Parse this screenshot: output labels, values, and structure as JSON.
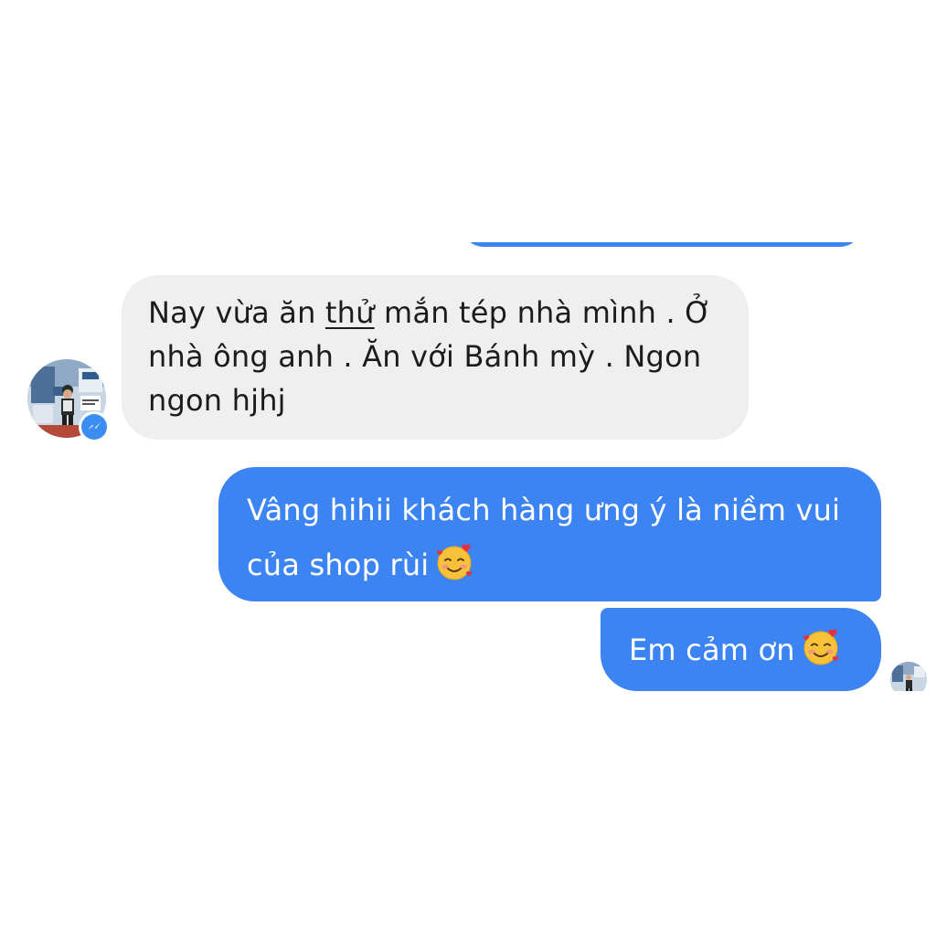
{
  "conversation": {
    "incoming": {
      "lines": [
        {
          "before": "Nay vừa ăn ",
          "underlined": "thử",
          "after": " mắn tép nhà mình . Ở"
        },
        {
          "text": "nhà ông anh . Ăn với Bánh mỳ . Ngon"
        },
        {
          "text": "ngon hjhj"
        }
      ]
    },
    "outgoing": [
      {
        "lines": [
          "Vâng hihii khách hàng ưng ý là niềm vui",
          "của shop rùi"
        ],
        "emoji": "smiling-face-with-hearts"
      },
      {
        "lines": [
          "Em cảm ơn"
        ],
        "emoji": "smiling-face-with-hearts"
      }
    ]
  },
  "colors": {
    "outgoing_bubble": "#3b84f1",
    "incoming_bubble": "#efefef",
    "incoming_text": "#1c1c1c",
    "outgoing_text": "#ffffff",
    "messenger_badge": "#3b8df2"
  },
  "icons": {
    "sender_avatar": "avatar",
    "badge": "messenger-icon",
    "emoji": "smiling-face-with-hearts-icon",
    "read_receipt": "seen-avatar"
  }
}
